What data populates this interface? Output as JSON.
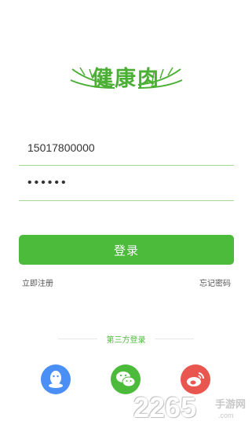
{
  "app": {
    "logo_text": "健康肉",
    "brand_color": "#4cba3a"
  },
  "form": {
    "phone_value": "15017800000",
    "password_value": "000000"
  },
  "actions": {
    "login_label": "登录",
    "register_label": "立即注册",
    "forgot_label": "忘记密码"
  },
  "third_party": {
    "title": "第三方登录",
    "providers": [
      {
        "name": "qq",
        "icon": "qq-icon",
        "color": "#4a8ff5"
      },
      {
        "name": "wechat",
        "icon": "wechat-icon",
        "color": "#4cba3a"
      },
      {
        "name": "weibo",
        "icon": "weibo-icon",
        "color": "#e9554f"
      }
    ]
  },
  "watermark": {
    "number": "2265",
    "name": "手游网",
    "url": ".com"
  }
}
